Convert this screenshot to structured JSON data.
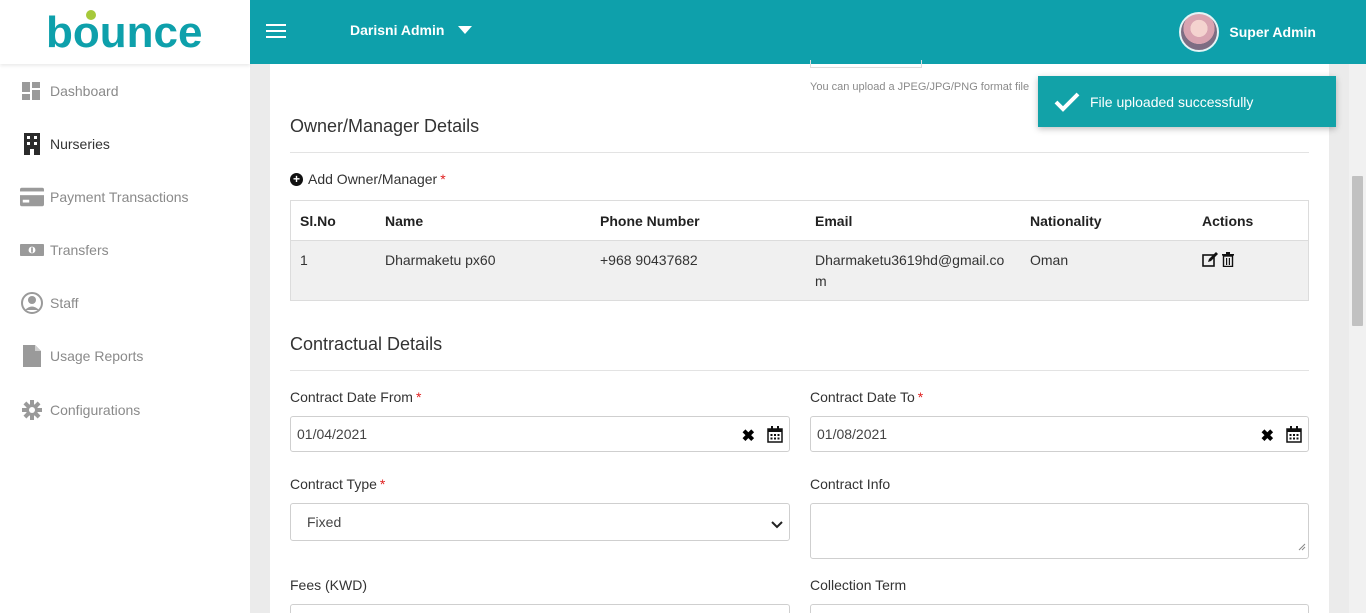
{
  "brand": {
    "logo_text": "bounce",
    "logo_color": "#0ea0ab",
    "logo_dot_color": "#a6c93a"
  },
  "sidebar": {
    "items": [
      {
        "label": "Dashboard",
        "icon": "dashboard-icon"
      },
      {
        "label": "Nurseries",
        "icon": "building-icon",
        "active": true
      },
      {
        "label": "Payment Transactions",
        "icon": "credit-card-icon"
      },
      {
        "label": "Transfers",
        "icon": "money-bill-icon"
      },
      {
        "label": "Staff",
        "icon": "user-circle-icon"
      },
      {
        "label": "Usage Reports",
        "icon": "file-icon"
      },
      {
        "label": "Configurations",
        "icon": "gear-icon"
      }
    ]
  },
  "topbar": {
    "admin_name": "Darisni Admin",
    "user_name": "Super Admin",
    "bg_color": "#0ea0ab"
  },
  "upload": {
    "hint": "You can upload a JPEG/JPG/PNG format file"
  },
  "owner_section": {
    "title": "Owner/Manager Details",
    "add_label": "Add Owner/Manager",
    "required_mark": "*",
    "columns": [
      "Sl.No",
      "Name",
      "Phone Number",
      "Email",
      "Nationality",
      "Actions"
    ],
    "rows": [
      {
        "sl": "1",
        "name": "Dharmaketu px60",
        "phone": "+968 90437682",
        "email": "Dharmaketu3619hd@gmail.com",
        "nationality": "Oman"
      }
    ]
  },
  "contract": {
    "title": "Contractual Details",
    "date_from_label": "Contract Date From",
    "date_from_value": "01/04/2021",
    "date_to_label": "Contract Date To",
    "date_to_value": "01/08/2021",
    "type_label": "Contract Type",
    "type_value": "Fixed",
    "info_label": "Contract Info",
    "info_value": "",
    "fees_label": "Fees (KWD)",
    "collection_label": "Collection Term",
    "required_mark": "*"
  },
  "toast": {
    "message": "File uploaded successfully",
    "color": "#12a2a8"
  }
}
